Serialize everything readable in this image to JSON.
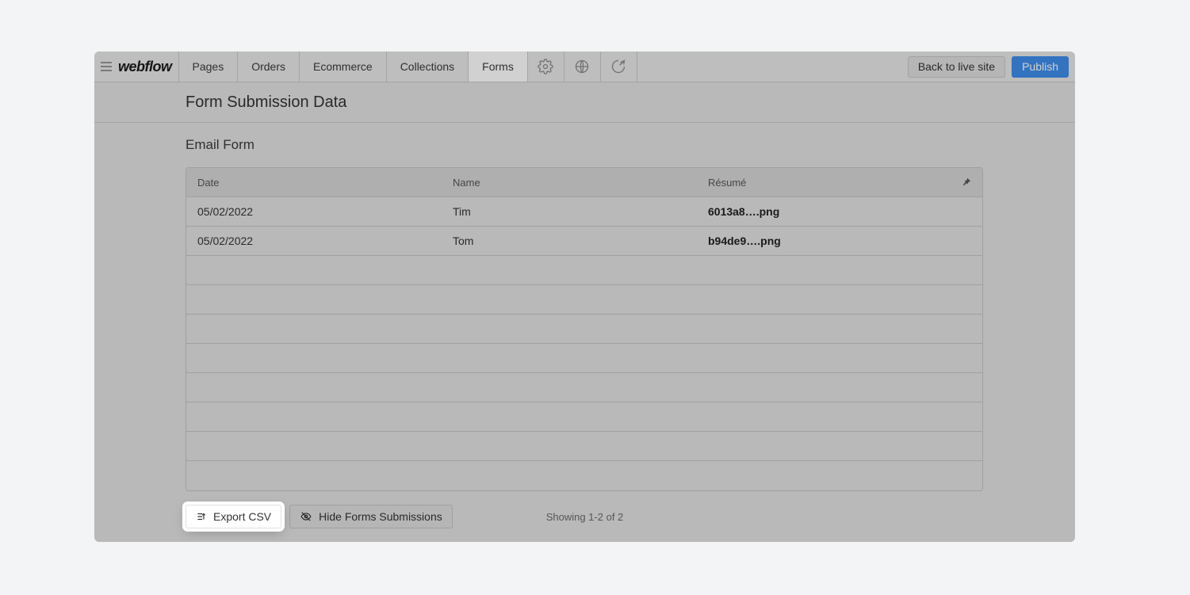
{
  "brand": "webflow",
  "nav": {
    "items": [
      {
        "label": "Pages"
      },
      {
        "label": "Orders"
      },
      {
        "label": "Ecommerce"
      },
      {
        "label": "Collections"
      },
      {
        "label": "Forms"
      }
    ]
  },
  "topbar": {
    "back": "Back to live site",
    "publish": "Publish"
  },
  "page_title": "Form Submission Data",
  "form_name": "Email Form",
  "table": {
    "headers": {
      "date": "Date",
      "name": "Name",
      "resume": "Résumé"
    },
    "rows": [
      {
        "date": "05/02/2022",
        "name": "Tim",
        "file": "6013a8….png"
      },
      {
        "date": "05/02/2022",
        "name": "Tom",
        "file": "b94de9….png"
      }
    ]
  },
  "actions": {
    "export": "Export CSV",
    "hide": "Hide Forms Submissions"
  },
  "pagination": "Showing 1-2 of 2"
}
